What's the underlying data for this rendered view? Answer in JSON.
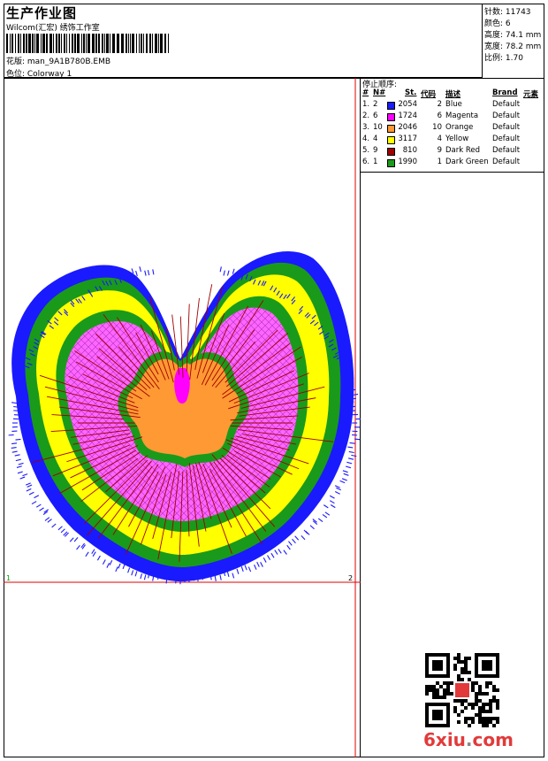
{
  "header": {
    "title": "生产作业图",
    "company": "Wilcom(汇宏) 绣饰工作室",
    "pattern": "花版: man_9A1B780B.EMB",
    "colorway": "色位: Colorway 1"
  },
  "stats": {
    "stitches": "针数: 11743",
    "colors": "颜色: 6",
    "height": "高度: 74.1 mm",
    "width": "宽度: 78.2 mm",
    "scale": "比例: 1.70"
  },
  "stop_sequence": {
    "label": "停止顺序:",
    "headers": [
      "#",
      "N#",
      "St.",
      "代码",
      "描述",
      "Brand",
      "元素"
    ],
    "rows": [
      {
        "idx": "1.",
        "n": "2",
        "color": "#1a1aff",
        "st": "2054",
        "code": "2",
        "desc": "Blue",
        "brand": "Default"
      },
      {
        "idx": "2.",
        "n": "6",
        "color": "#ff00ff",
        "st": "1724",
        "code": "6",
        "desc": "Magenta",
        "brand": "Default"
      },
      {
        "idx": "3.",
        "n": "10",
        "color": "#ff9933",
        "st": "2046",
        "code": "10",
        "desc": "Orange",
        "brand": "Default"
      },
      {
        "idx": "4.",
        "n": "4",
        "color": "#ffff00",
        "st": "3117",
        "code": "4",
        "desc": "Yellow",
        "brand": "Default"
      },
      {
        "idx": "5.",
        "n": "9",
        "color": "#a00000",
        "st": "810",
        "code": "9",
        "desc": "Dark Red",
        "brand": "Default"
      },
      {
        "idx": "6.",
        "n": "1",
        "color": "#1a9a1a",
        "st": "1990",
        "code": "1",
        "desc": "Dark Green",
        "brand": "Default"
      }
    ]
  },
  "design_area": {
    "corner_left": "1",
    "corner_right": "2",
    "guide_color": "#e00000"
  },
  "logo": {
    "text_main": "6xiu",
    "text_dot": ".",
    "text_tld": "com"
  }
}
